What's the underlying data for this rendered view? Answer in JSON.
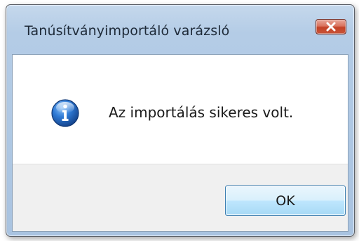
{
  "window": {
    "title": "Tanúsítványimportáló varázsló"
  },
  "titlebar": {
    "close_icon": "close-icon"
  },
  "message": {
    "icon": "info-icon",
    "text": "Az importálás sikeres volt."
  },
  "buttons": {
    "ok_label": "OK"
  },
  "colors": {
    "titlebar_glass": "#b4cce6",
    "close_button": "#c34227",
    "footer_background": "#f0f0f0",
    "ok_button_border": "#3c7fb1",
    "info_icon_blue": "#1f5fb5"
  }
}
